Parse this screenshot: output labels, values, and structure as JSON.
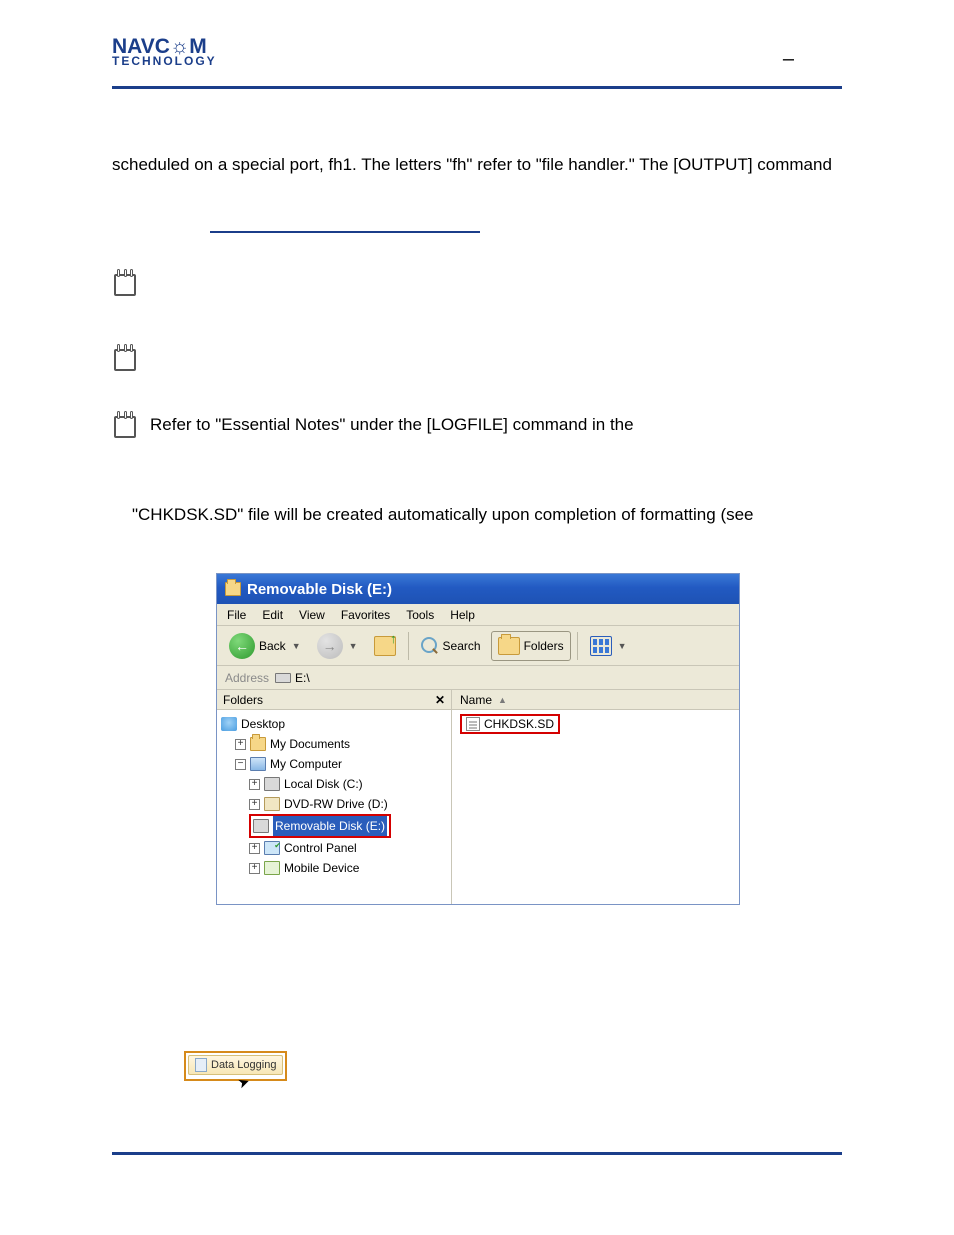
{
  "logo": {
    "line1": "NAVC☼M",
    "line2": "TECHNOLOGY"
  },
  "header_dash": "–",
  "para1": "scheduled on a special port, fh1. The letters \"fh\" refer to \"file handler.\" The [OUTPUT] command",
  "note3_text": "Refer to \"Essential Notes\" under the [LOGFILE] command in the",
  "para2": "\"CHKDSK.SD\" file will be created automatically upon completion of formatting (see",
  "explorer": {
    "title": "Removable Disk (E:)",
    "menu": {
      "file": "File",
      "edit": "Edit",
      "view": "View",
      "favorites": "Favorites",
      "tools": "Tools",
      "help": "Help"
    },
    "toolbar": {
      "back": "Back",
      "search": "Search",
      "folders": "Folders"
    },
    "address_label": "Address",
    "address_value": "E:\\",
    "folders_header": "Folders",
    "close_x": "✕",
    "tree": {
      "desktop": "Desktop",
      "mydocs": "My Documents",
      "mycomp": "My Computer",
      "localdisk": "Local Disk (C:)",
      "dvd": "DVD-RW Drive (D:)",
      "removable": "Removable Disk (E:)",
      "control": "Control Panel",
      "mobile": "Mobile Device"
    },
    "col_name": "Name",
    "file_name": "CHKDSK.SD"
  },
  "datalogging_label": "Data Logging"
}
